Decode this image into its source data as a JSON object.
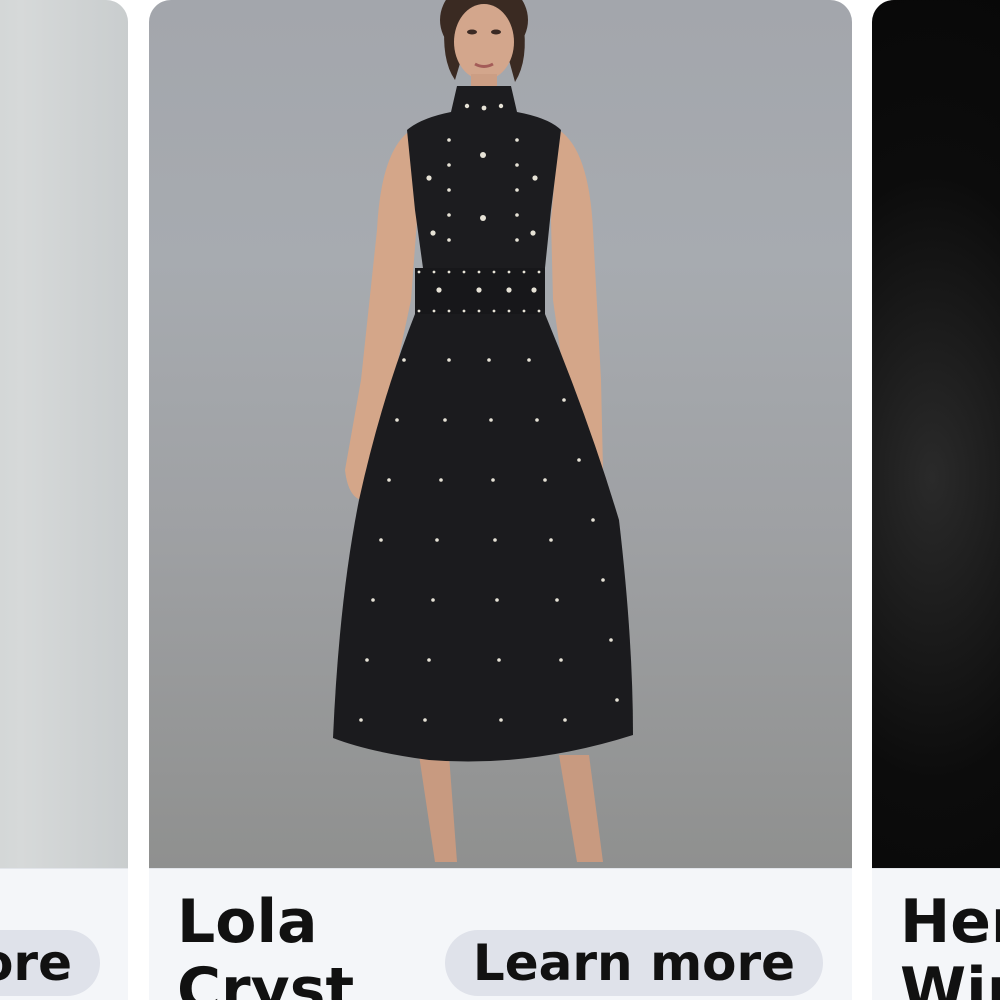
{
  "cards": [
    {
      "id": "left",
      "cta_label": "Learn more",
      "cta_visible_text": "ore"
    },
    {
      "id": "center",
      "title": "Lola\nCryst",
      "cta_label": "Learn more",
      "image_alt": "Black sleeveless high-neck midi dress with studded embellishments"
    },
    {
      "id": "right",
      "title": "Her\nWin"
    }
  ]
}
